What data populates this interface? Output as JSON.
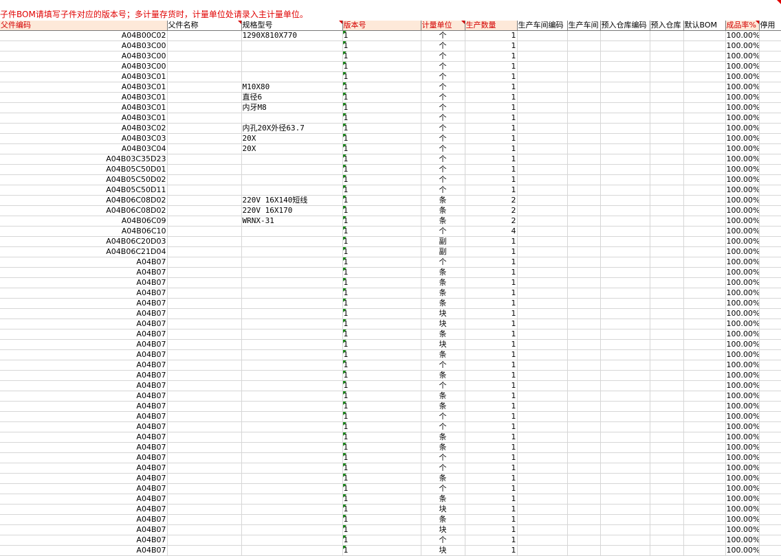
{
  "note": "子件BOM请填写子件对应的版本号；多计量存货时，计量单位处请录入主计量单位。",
  "headers": [
    "父件编码",
    "父件名称",
    "规格型号",
    "版本号",
    "计量单位",
    "生产数量",
    "生产车间编码",
    "生产车间",
    "预入仓库编码",
    "预入仓库",
    "默认BOM",
    "成品率%",
    "停用"
  ],
  "rows": [
    {
      "code": "A04B00C02",
      "spec": "1290X810X770",
      "ver": "1",
      "unit": "个",
      "qty": "1",
      "rate": "100.00%"
    },
    {
      "code": "A04B03C00",
      "spec": "",
      "ver": "1",
      "unit": "个",
      "qty": "1",
      "rate": "100.00%"
    },
    {
      "code": "A04B03C00",
      "spec": "",
      "ver": "1",
      "unit": "个",
      "qty": "1",
      "rate": "100.00%"
    },
    {
      "code": "A04B03C00",
      "spec": "",
      "ver": "1",
      "unit": "个",
      "qty": "1",
      "rate": "100.00%"
    },
    {
      "code": "A04B03C01",
      "spec": "",
      "ver": "1",
      "unit": "个",
      "qty": "1",
      "rate": "100.00%"
    },
    {
      "code": "A04B03C01",
      "spec": "M10X80",
      "ver": "1",
      "unit": "个",
      "qty": "1",
      "rate": "100.00%"
    },
    {
      "code": "A04B03C01",
      "spec": "直径6",
      "ver": "1",
      "unit": "个",
      "qty": "1",
      "rate": "100.00%"
    },
    {
      "code": "A04B03C01",
      "spec": "内牙M8",
      "ver": "1",
      "unit": "个",
      "qty": "1",
      "rate": "100.00%"
    },
    {
      "code": "A04B03C01",
      "spec": "",
      "ver": "1",
      "unit": "个",
      "qty": "1",
      "rate": "100.00%"
    },
    {
      "code": "A04B03C02",
      "spec": "内孔20X外径63.7",
      "ver": "1",
      "unit": "个",
      "qty": "1",
      "rate": "100.00%"
    },
    {
      "code": "A04B03C03",
      "spec": "20X",
      "ver": "1",
      "unit": "个",
      "qty": "1",
      "rate": "100.00%"
    },
    {
      "code": "A04B03C04",
      "spec": "20X",
      "ver": "1",
      "unit": "个",
      "qty": "1",
      "rate": "100.00%"
    },
    {
      "code": "A04B03C35D23",
      "spec": "",
      "ver": "1",
      "unit": "个",
      "qty": "1",
      "rate": "100.00%"
    },
    {
      "code": "A04B05C50D01",
      "spec": "",
      "ver": "1",
      "unit": "个",
      "qty": "1",
      "rate": "100.00%"
    },
    {
      "code": "A04B05C50D02",
      "spec": "",
      "ver": "1",
      "unit": "个",
      "qty": "1",
      "rate": "100.00%"
    },
    {
      "code": "A04B05C50D11",
      "spec": "",
      "ver": "1",
      "unit": "个",
      "qty": "1",
      "rate": "100.00%"
    },
    {
      "code": "A04B06C08D02",
      "spec": "220V 16X140短线",
      "ver": "1",
      "unit": "条",
      "qty": "2",
      "rate": "100.00%"
    },
    {
      "code": "A04B06C08D02",
      "spec": "220V 16X170",
      "ver": "1",
      "unit": "条",
      "qty": "2",
      "rate": "100.00%"
    },
    {
      "code": "A04B06C09",
      "spec": "WRNX-31",
      "ver": "1",
      "unit": "条",
      "qty": "2",
      "rate": "100.00%"
    },
    {
      "code": "A04B06C10",
      "spec": "",
      "ver": "1",
      "unit": "个",
      "qty": "4",
      "rate": "100.00%"
    },
    {
      "code": "A04B06C20D03",
      "spec": "",
      "ver": "1",
      "unit": "副",
      "qty": "1",
      "rate": "100.00%"
    },
    {
      "code": "A04B06C21D04",
      "spec": "",
      "ver": "1",
      "unit": "副",
      "qty": "1",
      "rate": "100.00%"
    },
    {
      "code": "A04B07",
      "spec": "",
      "ver": "1",
      "unit": "个",
      "qty": "1",
      "rate": "100.00%"
    },
    {
      "code": "A04B07",
      "spec": "",
      "ver": "1",
      "unit": "条",
      "qty": "1",
      "rate": "100.00%"
    },
    {
      "code": "A04B07",
      "spec": "",
      "ver": "1",
      "unit": "条",
      "qty": "1",
      "rate": "100.00%"
    },
    {
      "code": "A04B07",
      "spec": "",
      "ver": "1",
      "unit": "条",
      "qty": "1",
      "rate": "100.00%"
    },
    {
      "code": "A04B07",
      "spec": "",
      "ver": "1",
      "unit": "条",
      "qty": "1",
      "rate": "100.00%"
    },
    {
      "code": "A04B07",
      "spec": "",
      "ver": "1",
      "unit": "块",
      "qty": "1",
      "rate": "100.00%"
    },
    {
      "code": "A04B07",
      "spec": "",
      "ver": "1",
      "unit": "块",
      "qty": "1",
      "rate": "100.00%"
    },
    {
      "code": "A04B07",
      "spec": "",
      "ver": "1",
      "unit": "条",
      "qty": "1",
      "rate": "100.00%"
    },
    {
      "code": "A04B07",
      "spec": "",
      "ver": "1",
      "unit": "块",
      "qty": "1",
      "rate": "100.00%"
    },
    {
      "code": "A04B07",
      "spec": "",
      "ver": "1",
      "unit": "条",
      "qty": "1",
      "rate": "100.00%"
    },
    {
      "code": "A04B07",
      "spec": "",
      "ver": "1",
      "unit": "个",
      "qty": "1",
      "rate": "100.00%"
    },
    {
      "code": "A04B07",
      "spec": "",
      "ver": "1",
      "unit": "条",
      "qty": "1",
      "rate": "100.00%"
    },
    {
      "code": "A04B07",
      "spec": "",
      "ver": "1",
      "unit": "个",
      "qty": "1",
      "rate": "100.00%"
    },
    {
      "code": "A04B07",
      "spec": "",
      "ver": "1",
      "unit": "条",
      "qty": "1",
      "rate": "100.00%"
    },
    {
      "code": "A04B07",
      "spec": "",
      "ver": "1",
      "unit": "条",
      "qty": "1",
      "rate": "100.00%"
    },
    {
      "code": "A04B07",
      "spec": "",
      "ver": "1",
      "unit": "个",
      "qty": "1",
      "rate": "100.00%"
    },
    {
      "code": "A04B07",
      "spec": "",
      "ver": "1",
      "unit": "个",
      "qty": "1",
      "rate": "100.00%"
    },
    {
      "code": "A04B07",
      "spec": "",
      "ver": "1",
      "unit": "条",
      "qty": "1",
      "rate": "100.00%"
    },
    {
      "code": "A04B07",
      "spec": "",
      "ver": "1",
      "unit": "条",
      "qty": "1",
      "rate": "100.00%"
    },
    {
      "code": "A04B07",
      "spec": "",
      "ver": "1",
      "unit": "个",
      "qty": "1",
      "rate": "100.00%"
    },
    {
      "code": "A04B07",
      "spec": "",
      "ver": "1",
      "unit": "个",
      "qty": "1",
      "rate": "100.00%"
    },
    {
      "code": "A04B07",
      "spec": "",
      "ver": "1",
      "unit": "条",
      "qty": "1",
      "rate": "100.00%"
    },
    {
      "code": "A04B07",
      "spec": "",
      "ver": "1",
      "unit": "个",
      "qty": "1",
      "rate": "100.00%"
    },
    {
      "code": "A04B07",
      "spec": "",
      "ver": "1",
      "unit": "条",
      "qty": "1",
      "rate": "100.00%"
    },
    {
      "code": "A04B07",
      "spec": "",
      "ver": "1",
      "unit": "块",
      "qty": "1",
      "rate": "100.00%"
    },
    {
      "code": "A04B07",
      "spec": "",
      "ver": "1",
      "unit": "条",
      "qty": "1",
      "rate": "100.00%"
    },
    {
      "code": "A04B07",
      "spec": "",
      "ver": "1",
      "unit": "块",
      "qty": "1",
      "rate": "100.00%"
    },
    {
      "code": "A04B07",
      "spec": "",
      "ver": "1",
      "unit": "个",
      "qty": "1",
      "rate": "100.00%"
    },
    {
      "code": "A04B07",
      "spec": "",
      "ver": "1",
      "unit": "块",
      "qty": "1",
      "rate": "100.00%"
    }
  ]
}
